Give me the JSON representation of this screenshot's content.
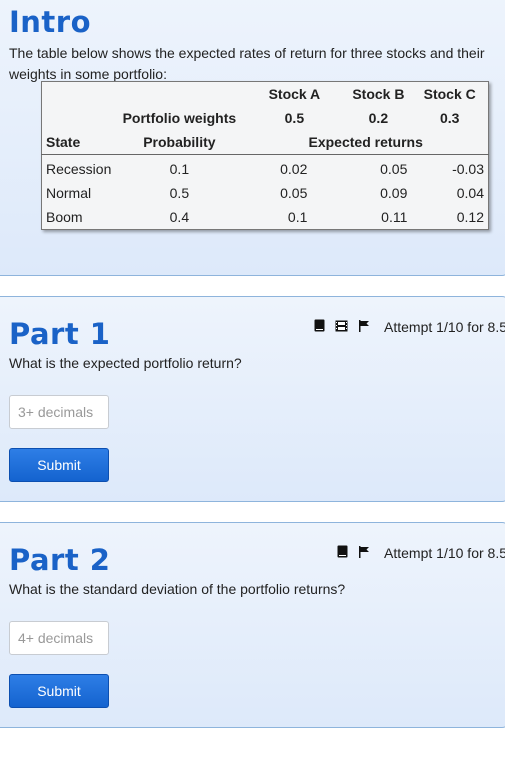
{
  "intro": {
    "title": "Intro",
    "description": "The table below shows the expected rates of return for three stocks and their weights in some portfolio:",
    "table": {
      "stock_headers": [
        "Stock A",
        "Stock B",
        "Stock C"
      ],
      "weights_label": "Portfolio weights",
      "weights": [
        "0.5",
        "0.2",
        "0.3"
      ],
      "state_label": "State",
      "probability_label": "Probability",
      "expected_returns_label": "Expected returns",
      "rows": [
        {
          "state": "Recession",
          "probability": "0.1",
          "a": "0.02",
          "b": "0.05",
          "c": "-0.03"
        },
        {
          "state": "Normal",
          "probability": "0.5",
          "a": "0.05",
          "b": "0.09",
          "c": "0.04"
        },
        {
          "state": "Boom",
          "probability": "0.4",
          "a": "0.1",
          "b": "0.11",
          "c": "0.12"
        }
      ]
    }
  },
  "part1": {
    "title": "Part 1",
    "attempt": "Attempt 1/10 for 8.5",
    "question": "What is the expected portfolio return?",
    "placeholder": "3+ decimals",
    "submit_label": "Submit",
    "icons": [
      "book-icon",
      "film-icon",
      "flag-icon"
    ]
  },
  "part2": {
    "title": "Part 2",
    "attempt": "Attempt 1/10 for 8.5",
    "question": "What is the standard deviation of the portfolio returns?",
    "placeholder": "4+ decimals",
    "submit_label": "Submit",
    "icons": [
      "book-icon",
      "flag-icon"
    ]
  },
  "colors": {
    "heading": "#1a62c7",
    "card_border": "#8eb4dc",
    "button": "#1463cf"
  }
}
